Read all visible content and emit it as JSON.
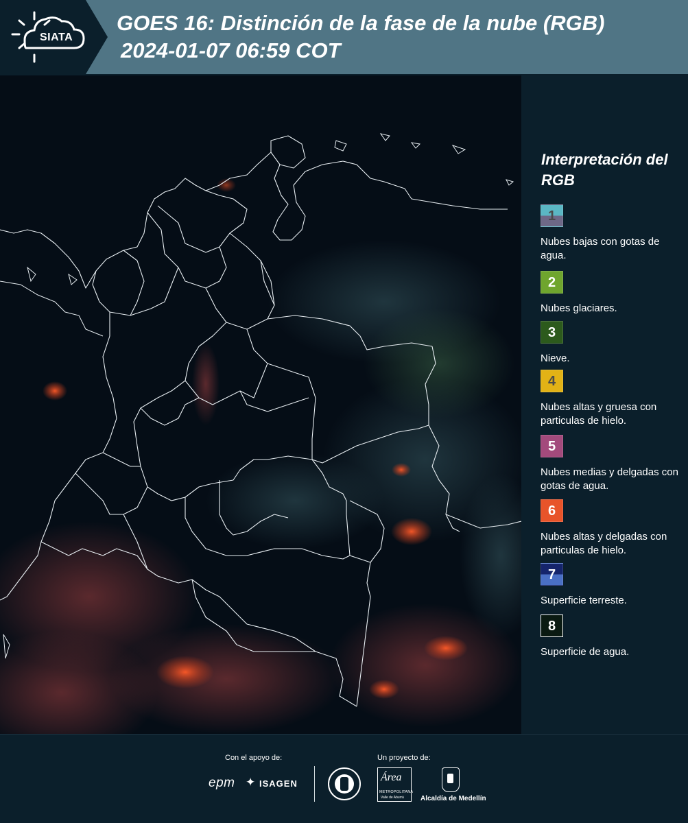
{
  "header": {
    "logo_text": "SIATA",
    "title_line1": "GOES 16: Distinción de la fase de la nube (RGB)",
    "title_line2": "2024-01-07 06:59 COT"
  },
  "legend": {
    "title": "Interpretación del RGB",
    "items": [
      {
        "number": "1",
        "label": "Nubes bajas con gotas de agua.",
        "colors": [
          "#5bb7c4",
          "#6e6887"
        ],
        "num_color": "#4a4a4a"
      },
      {
        "number": "2",
        "label": "Nubes glaciares.",
        "colors": [
          "#6fa52e"
        ],
        "num_color": "#ffffff"
      },
      {
        "number": "3",
        "label": "Nieve.",
        "colors": [
          "#2c5a1c"
        ],
        "num_color": "#ffffff"
      },
      {
        "number": "4",
        "label": "Nubes altas y gruesa con particulas de hielo.",
        "colors": [
          "#e2b216"
        ],
        "num_color": "#4a4a4a"
      },
      {
        "number": "5",
        "label": "Nubes medias y delgadas con gotas de agua.",
        "colors": [
          "#a34a7c"
        ],
        "num_color": "#ffffff"
      },
      {
        "number": "6",
        "label": "Nubes altas y delgadas con particulas de hielo.",
        "colors": [
          "#e8542a"
        ],
        "num_color": "#ffffff"
      },
      {
        "number": "7",
        "label": "Superficie terreste.",
        "colors": [
          "#15246b",
          "#4a6fc4"
        ],
        "num_color": "#ffffff"
      },
      {
        "number": "8",
        "label": "Superficie de agua.",
        "colors": [
          "#0a1a12"
        ],
        "num_color": "#ffffff"
      }
    ]
  },
  "footer": {
    "support_caption": "Con el apoyo de:",
    "project_caption": "Un proyecto de:",
    "sponsor_epm": "epm",
    "sponsor_isagen": "ISAGEN",
    "area_line1": "Área",
    "area_line2": "METROPOLITANA",
    "area_line3": "Valle de Aburrá",
    "alcaldia": "Alcaldía de Medellín"
  }
}
